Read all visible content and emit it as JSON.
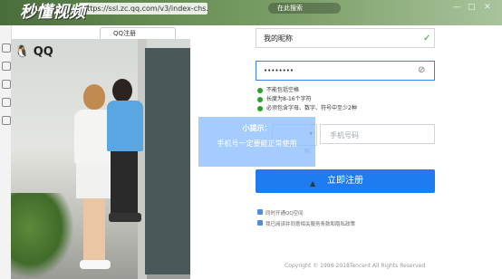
{
  "browser": {
    "watermark": "秒懂视频",
    "url": "https://ssl.zc.qq.com/v3/index-chs.html",
    "search_placeholder": "在此搜索",
    "tab_title": "QQ注册",
    "window_controls": [
      "—",
      "□",
      "✕"
    ]
  },
  "hero": {
    "logo_text": "QQ"
  },
  "tip": {
    "title": "小提示：",
    "body": "手机号一定要能正常使用"
  },
  "form": {
    "nickname_value": "我的昵称",
    "password_value": "••••••••",
    "password_rules": [
      "不能包括空格",
      "长度为8-16个字符",
      "必须包含字母、数字、符号中至少2种"
    ],
    "phone_placeholder": "手机号码",
    "phone_note": "码",
    "submit_label": "立即注册",
    "checkbox_1": "同时开通QQ空间",
    "checkbox_2": "我已阅读并同意相关服务条款和隐私政策"
  },
  "footer": {
    "copyright": "Copyright © 1998-2018Tencent All Rights Reserved"
  },
  "colors": {
    "primary_button": "#1e7bf0",
    "success": "#27a427",
    "tip_bg": "#8cbeff"
  }
}
